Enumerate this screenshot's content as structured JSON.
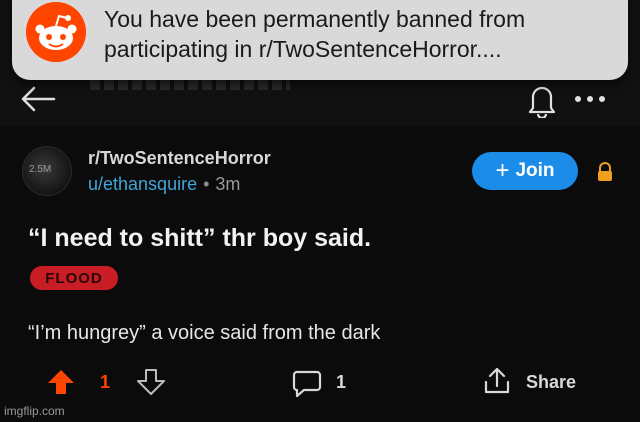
{
  "notification": {
    "line1": "You have been permanently banned from",
    "line2": "participating in r/TwoSentenceHorror...."
  },
  "post": {
    "avatar_label": "2.5M",
    "subreddit": "r/TwoSentenceHorror",
    "username": "u/ethansquire",
    "separator": "•",
    "age": "3m",
    "join_label": "Join",
    "join_plus": "+",
    "title": "“I need to shitt” thr boy said.",
    "flair": "FLOOD",
    "body": "“I’m hungrey” a voice said from the dark"
  },
  "actions": {
    "vote_count": "1",
    "comment_count": "1",
    "share_label": "Share"
  },
  "watermark": "imgflip.com",
  "colors": {
    "accent": "#1b8ce8",
    "upvote": "#ff4500",
    "flair": "#c81d25",
    "username": "#3fa6d8"
  }
}
